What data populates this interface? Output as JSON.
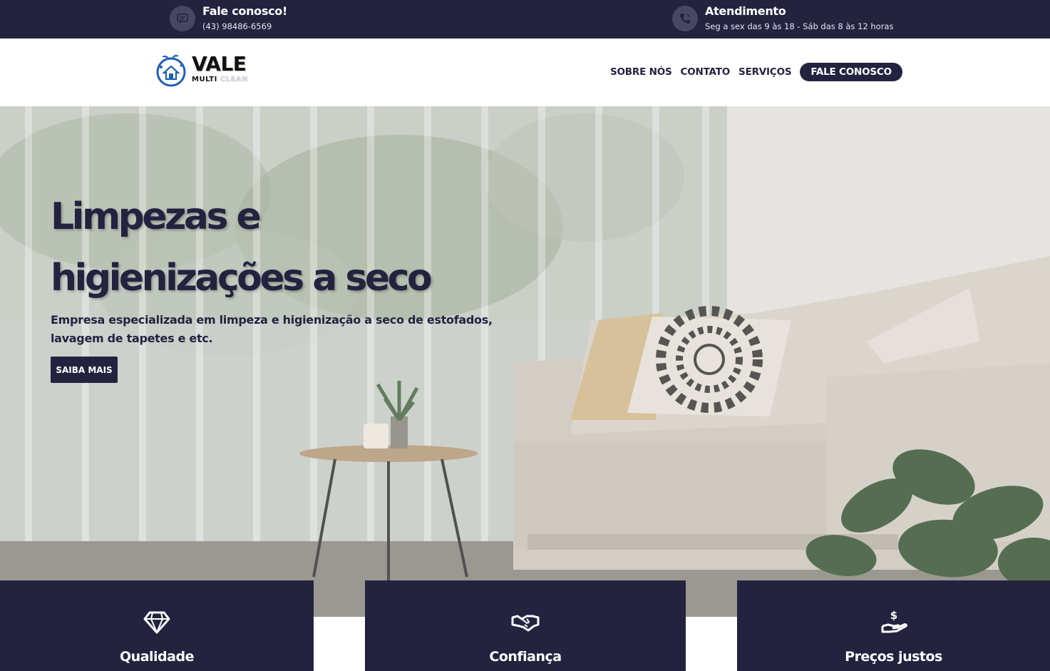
{
  "topbar": {
    "contact": {
      "title": "Fale conosco!",
      "subtitle": "(43) 98486-6569",
      "icon": "chat-icon"
    },
    "hours": {
      "title": "Atendimento",
      "subtitle": "Seg a sex das 9 às 18 - Sáb das 8 às 12 horas",
      "icon": "phone-icon"
    }
  },
  "header": {
    "logo": {
      "line1": "VALE",
      "line2a": "MULTI",
      "line2b": "CLEAN"
    },
    "nav": [
      {
        "label": "SOBRE NÓS"
      },
      {
        "label": "CONTATO"
      },
      {
        "label": "SERVIÇOS"
      }
    ],
    "cta": "FALE CONOSCO"
  },
  "hero": {
    "title_line1": "Limpezas e",
    "title_line2": "higienizações a seco",
    "description_line1": "Empresa especializada em limpeza e higienização a seco de estofados,",
    "description_line2": "lavagem de tapetes e etc.",
    "button": "SAIBA MAIS"
  },
  "features": [
    {
      "title": "Qualidade",
      "icon": "diamond-icon"
    },
    {
      "title": "Confiança",
      "icon": "handshake-icon"
    },
    {
      "title": "Preços justos",
      "icon": "hand-dollar-icon"
    }
  ],
  "colors": {
    "primary": "#232340",
    "white": "#ffffff"
  }
}
